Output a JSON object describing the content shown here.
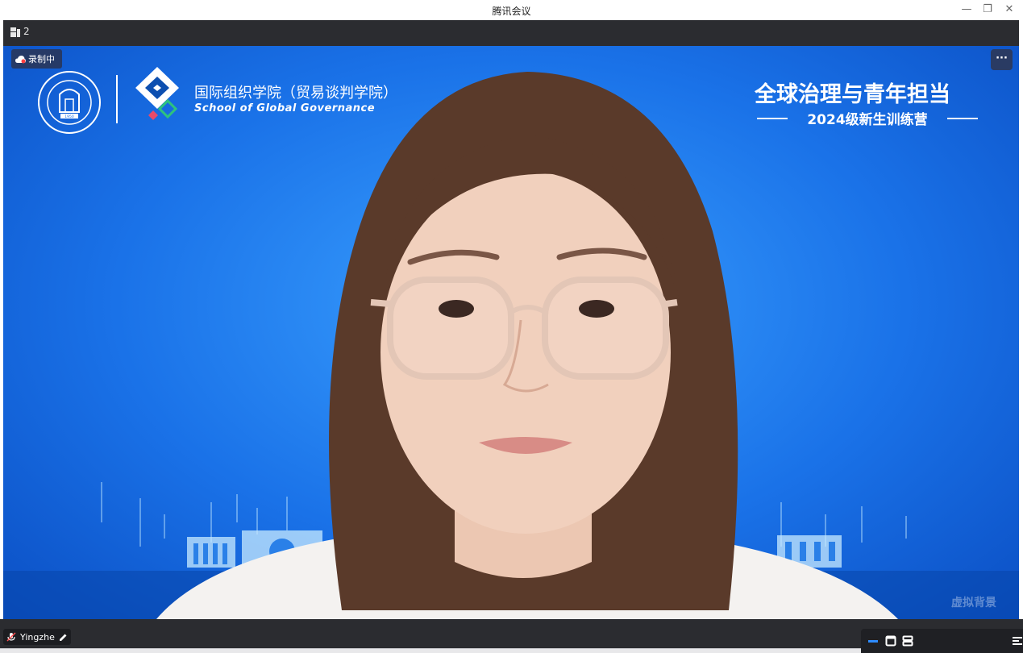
{
  "window": {
    "title": "腾讯会议",
    "controls": {
      "minimize": "—",
      "restore": "❐",
      "close": "✕"
    }
  },
  "toolbar": {
    "participant_count": "2",
    "icon": "participants-grid-icon"
  },
  "video": {
    "recording_label": "录制中",
    "more_label": "···",
    "school_name_cn": "国际组织学院（贸易谈判学院）",
    "school_name_en": "School of Global Governance",
    "event_title": "全球治理与青年担当",
    "event_subtitle": "2024级新生训练营",
    "seal_year": "1950",
    "virtual_bg_label": "虚拟背景",
    "participant_name": "Yingzhe"
  },
  "colors": {
    "bg_blue": "#1a72e8",
    "bar_dark": "#2b2c30",
    "rec_badge": "#263a66",
    "accent_blue": "#1e90ff"
  }
}
